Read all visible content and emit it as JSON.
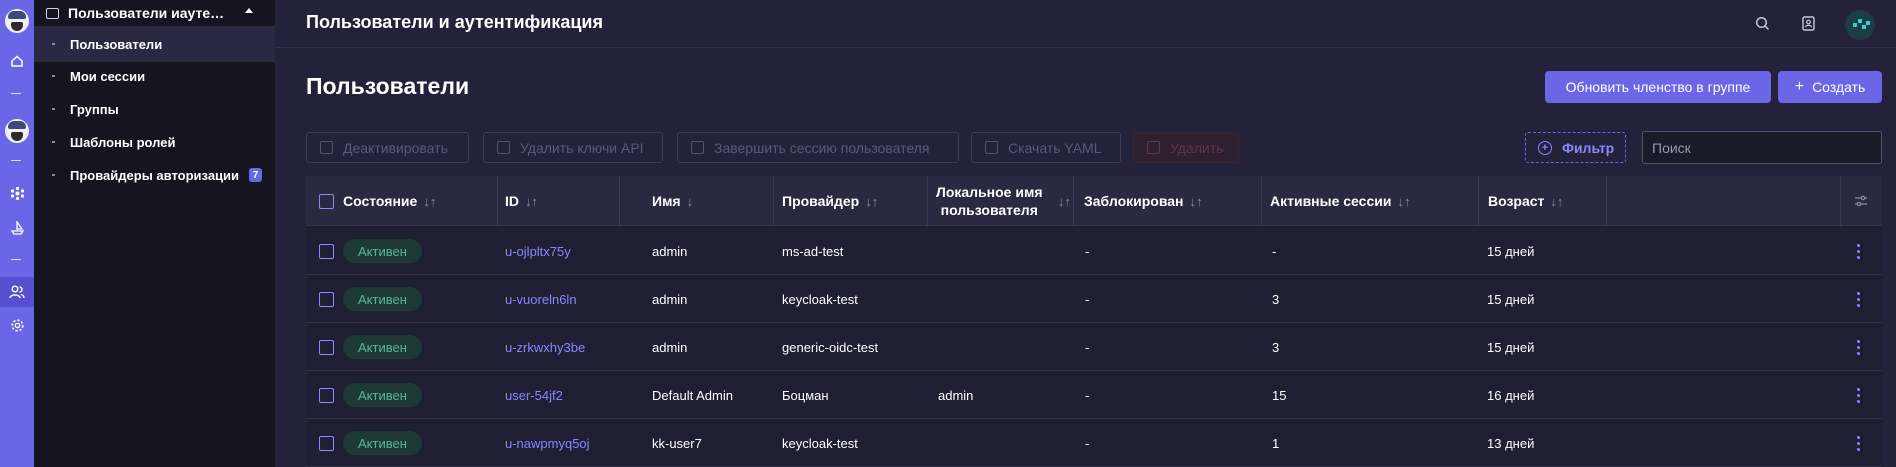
{
  "sidebar": {
    "section_title": "Пользователи иауте…",
    "items": [
      {
        "label": "Пользователи"
      },
      {
        "label": "Мои сессии"
      },
      {
        "label": "Группы"
      },
      {
        "label": "Шаблоны ролей"
      },
      {
        "label": "Провайдеры авторизации",
        "badge": "7"
      }
    ]
  },
  "header": {
    "title": "Пользователи и аутентификация"
  },
  "page": {
    "title": "Пользователи"
  },
  "actions": {
    "update_membership": "Обновить членство в группе",
    "create": "Создать"
  },
  "toolbar": {
    "deactivate": "Деактивировать",
    "delete_api_keys": "Удалить ключи API",
    "end_session": "Завершить сессию пользователя",
    "download_yaml": "Скачать YAML",
    "delete": "Удалить",
    "filter": "Фильтр",
    "search_placeholder": "Поиск"
  },
  "table": {
    "columns": {
      "state": "Состояние",
      "id": "ID",
      "name": "Имя",
      "provider": "Провайдер",
      "local_name_1": "Локальное имя",
      "local_name_2": "пользователя",
      "blocked": "Заблокирован",
      "sessions": "Активные сессии",
      "age": "Возраст"
    },
    "sort_glyph": "↓↑",
    "sort_desc_glyph": "↓",
    "rows": [
      {
        "status": "Активен",
        "id": "u-ojlpltx75y",
        "name": "admin",
        "provider": "ms-ad-test",
        "local_name": "",
        "blocked": "-",
        "sessions": "-",
        "age": "15 дней"
      },
      {
        "status": "Активен",
        "id": "u-vuoreln6ln",
        "name": "admin",
        "provider": "keycloak-test",
        "local_name": "",
        "blocked": "-",
        "sessions": "3",
        "age": "15 дней"
      },
      {
        "status": "Активен",
        "id": "u-zrkwxhy3be",
        "name": "admin",
        "provider": "generic-oidc-test",
        "local_name": "",
        "blocked": "-",
        "sessions": "3",
        "age": "15 дней"
      },
      {
        "status": "Активен",
        "id": "user-54jf2",
        "name": "Default Admin",
        "provider": "Боцман",
        "local_name": "admin",
        "blocked": "-",
        "sessions": "15",
        "age": "16 дней"
      },
      {
        "status": "Активен",
        "id": "u-nawpmyq5oj",
        "name": "kk-user7",
        "provider": "keycloak-test",
        "local_name": "",
        "blocked": "-",
        "sessions": "1",
        "age": "13 дней"
      }
    ]
  }
}
